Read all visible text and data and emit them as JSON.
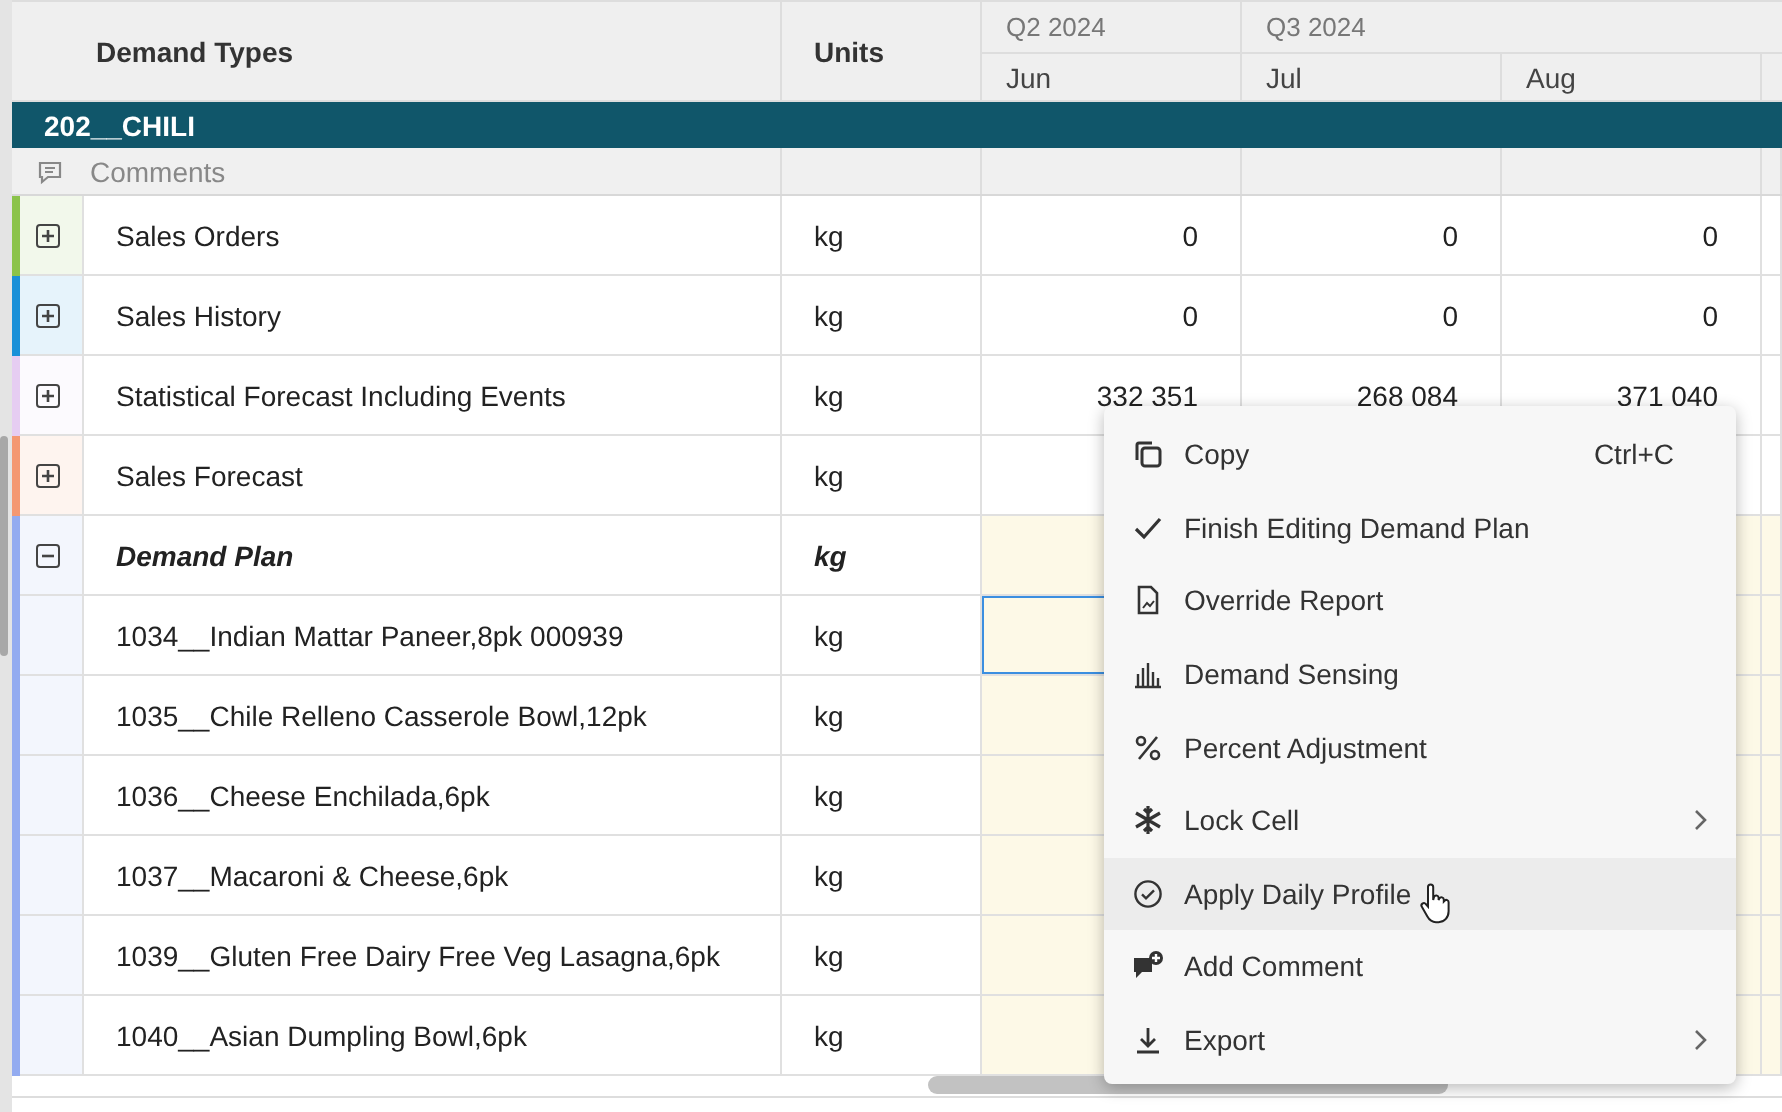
{
  "table": {
    "columns": [
      "Demand Types",
      "Units"
    ],
    "periods": [
      {
        "quarter": "Q2 2024",
        "months": [
          "Jun"
        ]
      },
      {
        "quarter": "Q3 2024",
        "months": [
          "Jul",
          "Aug"
        ]
      }
    ],
    "group": "202__CHILI",
    "comments": "Comments",
    "rows": [
      {
        "kind": "measure",
        "name": "Sales Orders",
        "units": "kg",
        "color": "#8bc34a",
        "expanded": false,
        "values": [
          "0",
          "0",
          "0"
        ]
      },
      {
        "kind": "measure",
        "name": "Sales History",
        "units": "kg",
        "color": "#1a90d8",
        "expanded": false,
        "values": [
          "0",
          "0",
          "0"
        ]
      },
      {
        "kind": "measure",
        "name": "Statistical Forecast Including Events",
        "units": "kg",
        "color": "#e6cdf2",
        "expanded": false,
        "values": [
          "332 351",
          "268 084",
          "371 040"
        ]
      },
      {
        "kind": "measure",
        "name": "Sales Forecast",
        "units": "kg",
        "color": "#f49872",
        "expanded": false
      },
      {
        "kind": "plan",
        "name": "Demand Plan",
        "units": "kg",
        "color": "#93abf0",
        "expanded": true,
        "children": [
          {
            "name": "1034__Indian Mattar Paneer,8pk 000939",
            "units": "kg",
            "selected": true
          },
          {
            "name": "1035__Chile Relleno Casserole Bowl,12pk",
            "units": "kg",
            "selected": false
          },
          {
            "name": "1036__Cheese Enchilada,6pk",
            "units": "kg",
            "selected": false
          },
          {
            "name": "1037__Macaroni & Cheese,6pk",
            "units": "kg",
            "selected": false
          },
          {
            "name": "1039__Gluten Free Dairy Free Veg Lasagna,6pk",
            "units": "kg",
            "selected": false
          },
          {
            "name": "1040__Asian Dumpling Bowl,6pk",
            "units": "kg",
            "selected": false
          }
        ]
      }
    ]
  },
  "context_menu": {
    "items": [
      {
        "label": "Copy",
        "shortcut": "Ctrl+C",
        "submenu": false,
        "hovered": false
      },
      {
        "label": "Finish Editing Demand Plan",
        "submenu": false,
        "hovered": false
      },
      {
        "label": "Override Report",
        "submenu": false,
        "hovered": false
      },
      {
        "label": "Demand Sensing",
        "submenu": false,
        "hovered": false
      },
      {
        "label": "Percent Adjustment",
        "submenu": false,
        "hovered": false
      },
      {
        "label": "Lock Cell",
        "submenu": true,
        "hovered": false
      },
      {
        "label": "Apply Daily Profile",
        "submenu": false,
        "hovered": true
      },
      {
        "label": "Add Comment",
        "submenu": false,
        "hovered": false
      },
      {
        "label": "Export",
        "submenu": true,
        "hovered": false
      }
    ]
  }
}
